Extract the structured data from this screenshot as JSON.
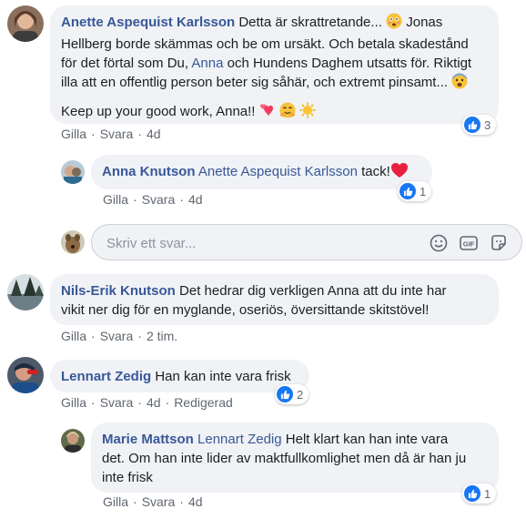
{
  "colors": {
    "link": "#385898",
    "like_blue": "#1877f2",
    "bubble_bg": "#f0f2f5",
    "meta": "#606770"
  },
  "comments": [
    {
      "author": "Anette Aspequist Karlsson",
      "text_1": "Detta är skrattretande...",
      "text_2": "Jonas",
      "text_3": "Hellberg borde skämmas och be om ursäkt. Och betala skadestånd",
      "text_4a": "för det förtal som Du,",
      "mention": "Anna",
      "text_4b": "och Hundens Daghem utsatts för. Riktigt",
      "text_5": "illa att en offentlig person beter sig såhär, och extremt pinsamt...",
      "text_6": "Keep up your good work, Anna!!",
      "like": "Gilla",
      "reply": "Svara",
      "time": "4d",
      "reactions": "3",
      "emoji_names": [
        "flushed-face-emoji",
        "fearful-face-emoji",
        "hearts-emoji",
        "hug-face-emoji",
        "sun-emoji"
      ]
    },
    {
      "author": "Anna Knutson",
      "mention": "Anette Aspequist Karlsson",
      "text": "tack!",
      "like": "Gilla",
      "reply": "Svara",
      "time": "4d",
      "reactions": "1",
      "emoji_names": [
        "red-heart-emoji"
      ]
    },
    {
      "author": "Nils-Erik Knutson",
      "text_1": "Det hedrar dig verkligen Anna att du inte har",
      "text_2": "vikit ner dig för en myglande, oseriös, översittande skitstövel!",
      "like": "Gilla",
      "reply": "Svara",
      "time": "2 tim."
    },
    {
      "author": "Lennart Zedig",
      "text": "Han kan inte vara frisk",
      "like": "Gilla",
      "reply": "Svara",
      "time": "4d",
      "edited": "Redigerad",
      "reactions": "2"
    },
    {
      "author": "Marie Mattson",
      "mention": "Lennart Zedig",
      "text_1": "Helt klart kan han inte vara",
      "text_2": "det. Om han inte lider av maktfullkomlighet men då är han ju",
      "text_3": "inte frisk",
      "like": "Gilla",
      "reply": "Svara",
      "time": "4d",
      "reactions": "1"
    }
  ],
  "reply_box": {
    "placeholder": "Skriv ett svar...",
    "icons": [
      "smiley-icon",
      "gif-icon",
      "sticker-icon"
    ]
  }
}
